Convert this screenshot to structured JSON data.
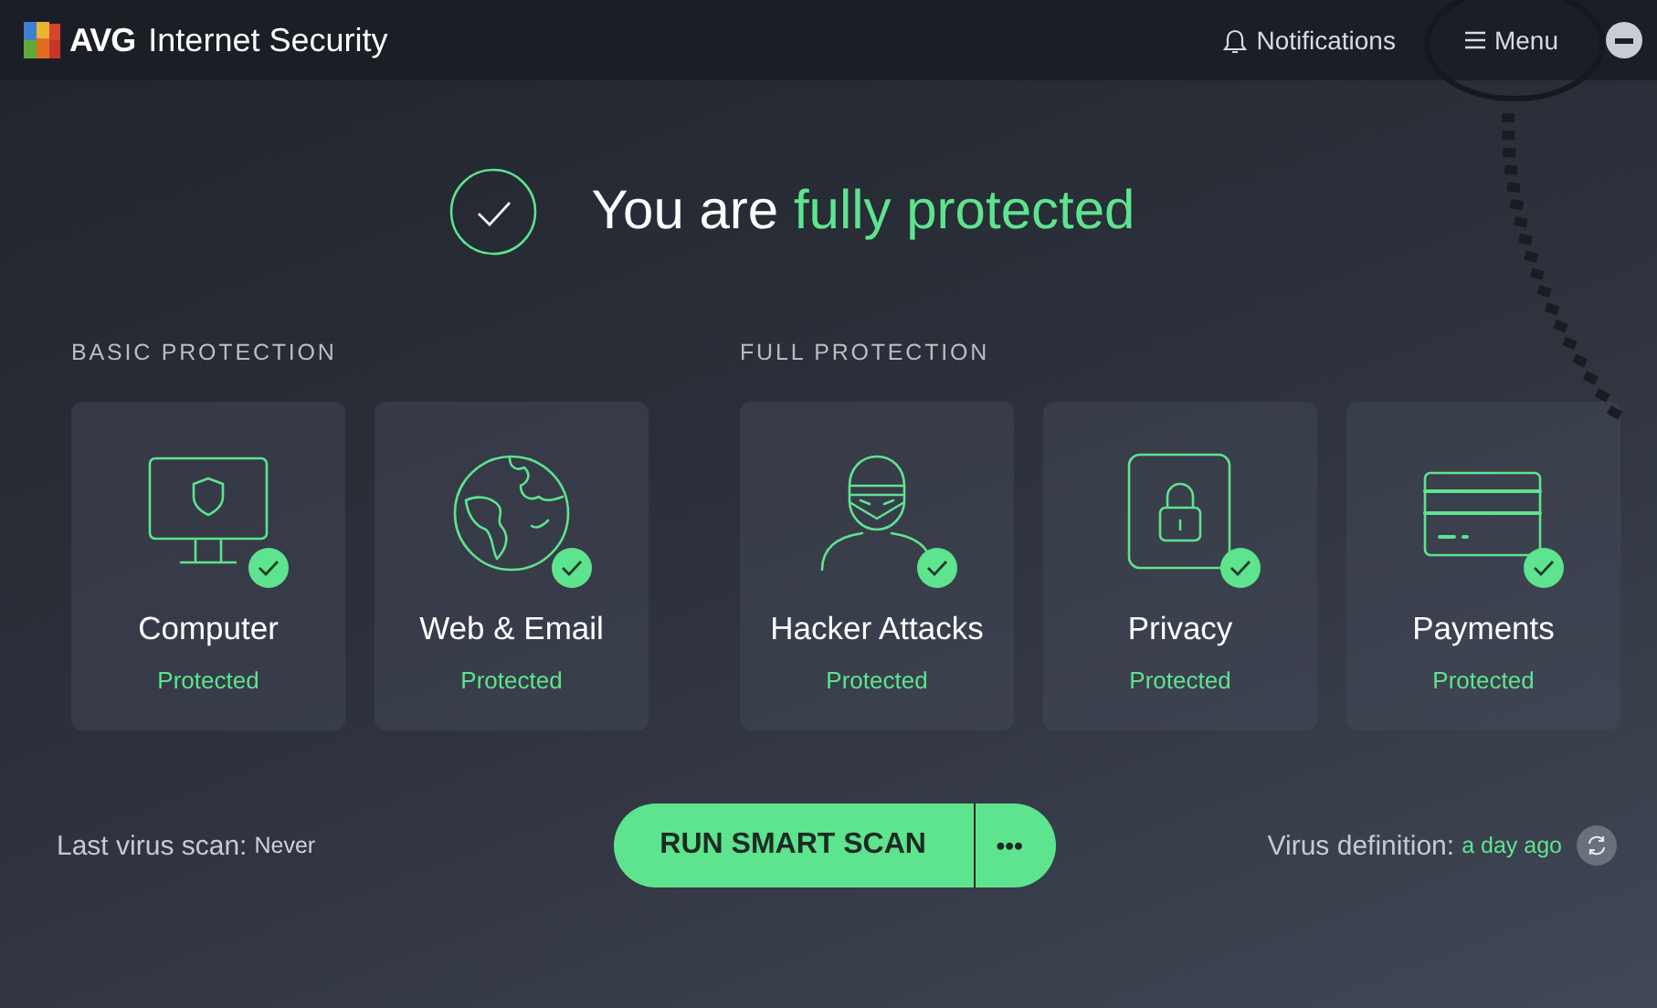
{
  "app": {
    "logo_text": "AVG",
    "title": "Internet Security"
  },
  "header": {
    "notifications": "Notifications",
    "menu": "Menu"
  },
  "status": {
    "prefix": "You are",
    "highlight": "fully protected",
    "protected": true
  },
  "sections": [
    {
      "title": "BASIC PROTECTION",
      "cards": [
        {
          "kind": "computer",
          "title": "Computer",
          "status": "Protected",
          "ok": true
        },
        {
          "kind": "globe",
          "title": "Web & Email",
          "status": "Protected",
          "ok": true
        }
      ]
    },
    {
      "title": "FULL PROTECTION",
      "cards": [
        {
          "kind": "hacker",
          "title": "Hacker Attacks",
          "status": "Protected",
          "ok": true
        },
        {
          "kind": "privacy",
          "title": "Privacy",
          "status": "Protected",
          "ok": true
        },
        {
          "kind": "payments",
          "title": "Payments",
          "status": "Protected",
          "ok": true
        }
      ]
    }
  ],
  "footer": {
    "last_scan_label": "Last virus scan:",
    "last_scan_value": "Never",
    "scan_button": "RUN SMART SCAN",
    "more_button": "•••",
    "definition_label": "Virus definition:",
    "definition_value": "a day ago"
  }
}
